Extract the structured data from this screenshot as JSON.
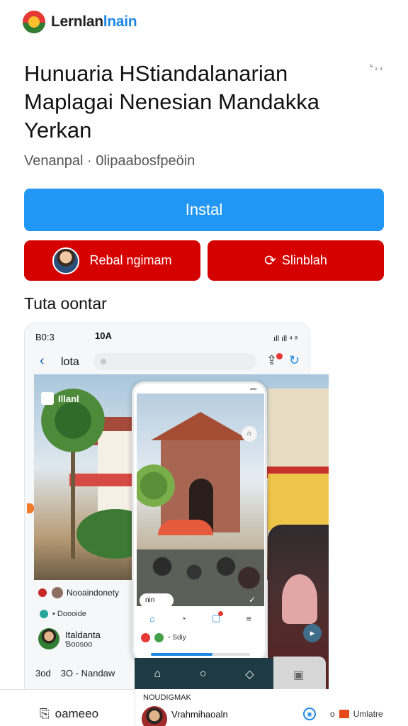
{
  "header": {
    "brand_part1": "Lernlan",
    "brand_part2": "lnain",
    "logo_icon": "circular-flag-logo"
  },
  "title": "Hunuaria HStiandalanarian Maplagai Nenesian Mandakka Yerkan",
  "corner_note": "ᵏ ₃ ₄",
  "subtitle": "Venanpal · 0lipaabosfpeöin",
  "actions": {
    "install_label": "Instal",
    "left_button_label": "Rebal ngimam",
    "right_button_label": "Slinblah",
    "right_button_icon": "share-icon"
  },
  "section_title": "Tuta oontar",
  "preview": {
    "status_time": "B0:3",
    "status_center": "10A",
    "status_right": "ıll ıll ⁴ ᵃ",
    "appbar_title": "lota",
    "scene_label": "Illanl",
    "feed_user": "Nooaindonety",
    "feed_meta": "• Doooide",
    "profile_name": "Italdanta",
    "profile_sub": "Ɓoosoo",
    "stats_left": "3od",
    "stats_right": "3O - Nandaw",
    "inner": {
      "status": "ᵃᵃᵃ",
      "help_icon_text": "⌂",
      "chip_label": "nin",
      "row_text": "◦ Sdiy",
      "progress": 0.62
    }
  },
  "bottom": {
    "left_label": "oameeo",
    "card_title": "NOUDIGMAK",
    "card_name": "Vrahmihaoaln",
    "card_right": "Umlatre",
    "card_count": "o"
  },
  "colors": {
    "install_blue": "#2196f3",
    "action_red": "#d50000",
    "brand_blue": "#1e88e5",
    "nav_dark": "#1e3b43"
  }
}
